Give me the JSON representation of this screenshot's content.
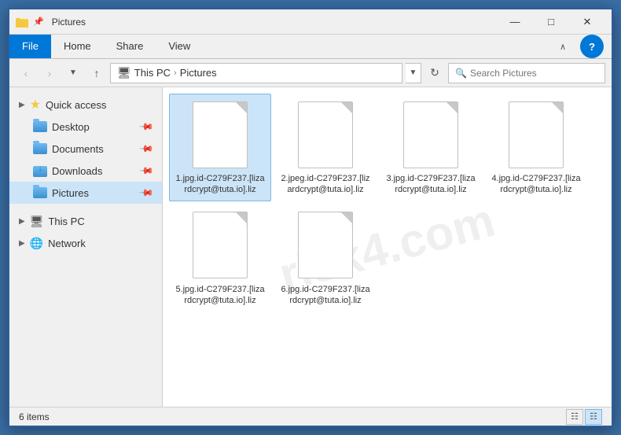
{
  "window": {
    "title": "Pictures",
    "icon": "folder-icon"
  },
  "title_bar": {
    "controls": {
      "minimize": "—",
      "maximize": "□",
      "close": "✕"
    }
  },
  "ribbon": {
    "tabs": [
      {
        "label": "File",
        "active": true
      },
      {
        "label": "Home",
        "active": false
      },
      {
        "label": "Share",
        "active": false
      },
      {
        "label": "View",
        "active": false
      }
    ],
    "help_label": "?"
  },
  "address_bar": {
    "back_label": "‹",
    "forward_label": "›",
    "up_label": "↑",
    "path": [
      "This PC",
      "Pictures"
    ],
    "refresh_label": "↻",
    "search_placeholder": "Search Pictures"
  },
  "sidebar": {
    "sections": [
      {
        "header": "Quick access",
        "items": [
          {
            "label": "Desktop",
            "type": "folder-pin"
          },
          {
            "label": "Documents",
            "type": "folder-pin"
          },
          {
            "label": "Downloads",
            "type": "downloads-pin"
          },
          {
            "label": "Pictures",
            "type": "folder-pin",
            "active": true
          }
        ]
      },
      {
        "items": [
          {
            "label": "This PC",
            "type": "pc"
          },
          {
            "label": "Network",
            "type": "network"
          }
        ]
      }
    ]
  },
  "files": [
    {
      "name": "1.jpg.id-C279F237.[lizardcrypt@tuta.io].liz",
      "selected": true
    },
    {
      "name": "2.jpeg.id-C279F237.[lizardcrypt@tuta.io].liz",
      "selected": false
    },
    {
      "name": "3.jpg.id-C279F237.[lizardcrypt@tuta.io].liz",
      "selected": false
    },
    {
      "name": "4.jpg.id-C279F237.[lizardcrypt@tuta.io].liz",
      "selected": false
    },
    {
      "name": "5.jpg.id-C279F237.[lizardcrypt@tuta.io].liz",
      "selected": false
    },
    {
      "name": "6.jpg.id-C279F237.[lizardcrypt@tuta.io].liz",
      "selected": false
    }
  ],
  "status_bar": {
    "count_label": "6 items"
  },
  "watermark": "risk4.com"
}
